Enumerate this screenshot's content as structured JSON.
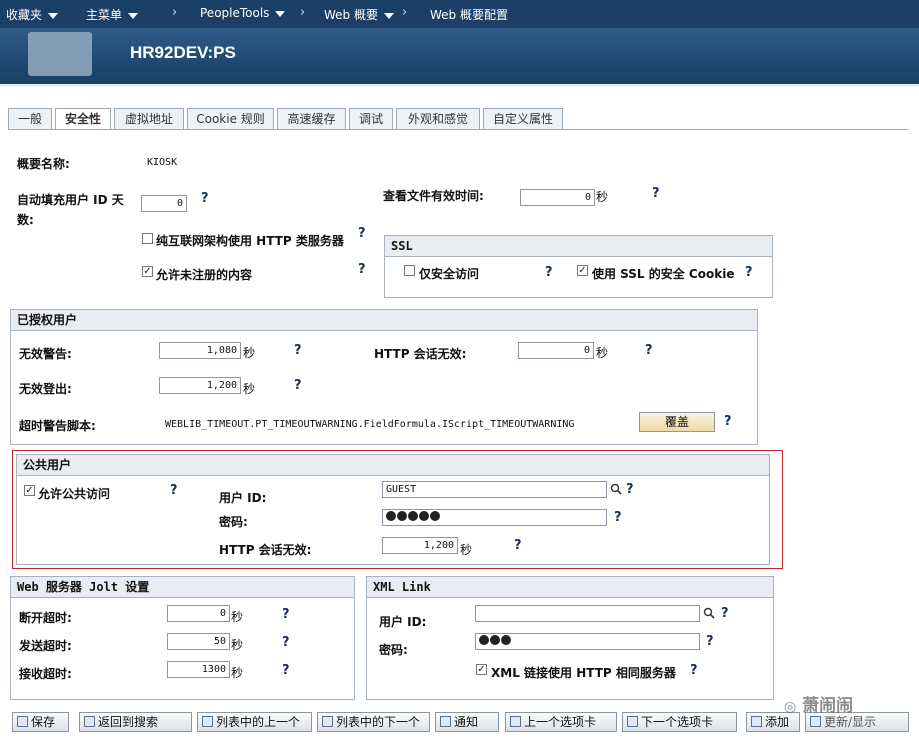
{
  "nav": {
    "favorites": "收藏夹",
    "main_menu": "主菜单",
    "crumbs": [
      "PeopleTools",
      "Web 概要",
      "Web 概要配置"
    ]
  },
  "banner": {
    "host": "HR92DEV:PS"
  },
  "tabs": [
    "一般",
    "安全性",
    "虚拟地址",
    "Cookie 规则",
    "高速缓存",
    "调试",
    "外观和感觉",
    "自定义属性"
  ],
  "general": {
    "profile_name_label": "概要名称:",
    "profile_name_value": "KIOSK",
    "autofill_label": "自动填充用户 ID 天数:",
    "autofill_value": "0",
    "view_file_label": "查看文件有效时间:",
    "view_file_value": "0",
    "view_file_unit": "秒",
    "pure_internet_label": "纯互联网架构使用 HTTP 类服务器",
    "allow_unregistered_label": "允许未注册的内容",
    "help": "?"
  },
  "ssl": {
    "title": "SSL",
    "secure_only_label": "仅安全访问",
    "secure_cookie_label": "使用 SSL 的安全 Cookie"
  },
  "authorized": {
    "title": "已授权用户",
    "inactivity_warning_label": "无效警告:",
    "inactivity_warning_value": "1,080",
    "http_session_label": "HTTP 会话无效:",
    "http_session_value": "0",
    "inactivity_logout_label": "无效登出:",
    "inactivity_logout_value": "1,200",
    "timeout_script_label": "超时警告脚本:",
    "timeout_script_value": "WEBLIB_TIMEOUT.PT_TIMEOUTWARNING.FieldFormula.IScript_TIMEOUTWARNING",
    "override_button": "覆盖",
    "unit": "秒"
  },
  "public": {
    "title": "公共用户",
    "allow_public_label": "允许公共访问",
    "user_id_label": "用户 ID:",
    "user_id_value": "GUEST",
    "password_label": "密码:",
    "http_session_label": "HTTP 会话无效:",
    "http_session_value": "1,200",
    "unit": "秒"
  },
  "jolt": {
    "title": "Web 服务器 Jolt 设置",
    "disconnect_label": "断开超时:",
    "disconnect_value": "0",
    "send_label": "发送超时:",
    "send_value": "50",
    "receive_label": "接收超时:",
    "receive_value": "1300",
    "unit": "秒"
  },
  "xml": {
    "title": "XML Link",
    "user_id_label": "用户 ID:",
    "user_id_value": "",
    "password_label": "密码:",
    "same_server_label": "XML 链接使用 HTTP 相同服务器"
  },
  "toolbar": [
    "保存",
    "返回到搜索",
    "列表中的上一个",
    "列表中的下一个",
    "通知",
    "上一个选项卡",
    "下一个选项卡",
    "添加",
    "更新/显示"
  ],
  "watermark": "萧闹闹"
}
